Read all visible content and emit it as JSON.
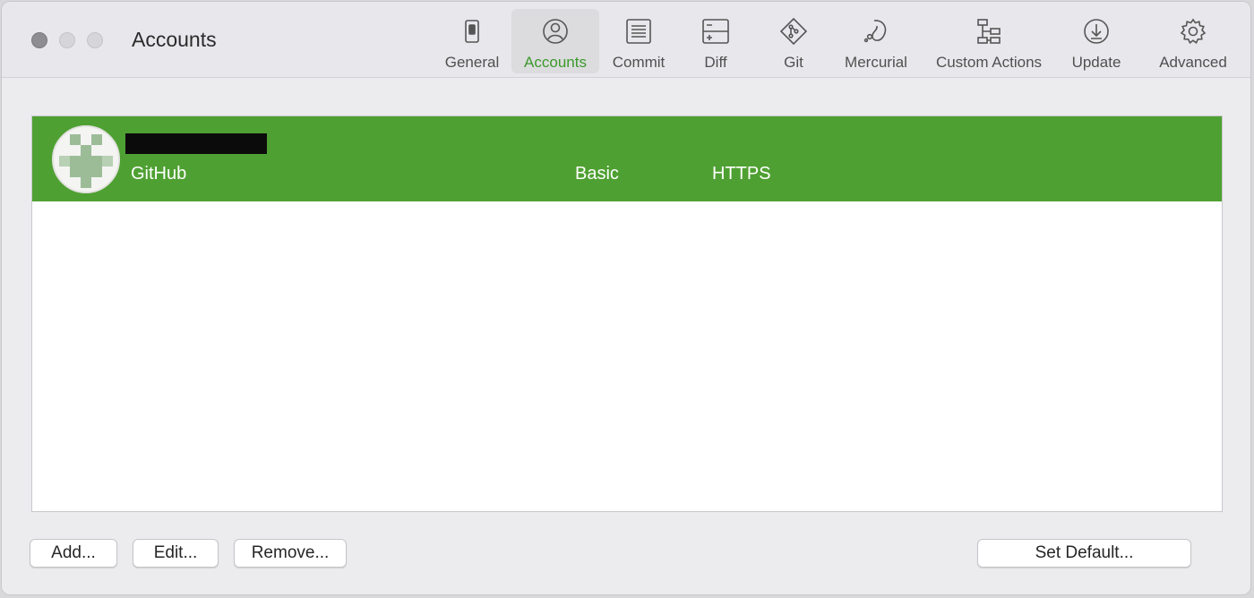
{
  "window": {
    "title": "Accounts"
  },
  "toolbar": {
    "items": [
      {
        "label": "General",
        "icon": "general-icon"
      },
      {
        "label": "Accounts",
        "icon": "accounts-icon",
        "active": true
      },
      {
        "label": "Commit",
        "icon": "commit-icon"
      },
      {
        "label": "Diff",
        "icon": "diff-icon"
      },
      {
        "label": "Git",
        "icon": "git-icon"
      },
      {
        "label": "Mercurial",
        "icon": "mercurial-icon"
      },
      {
        "label": "Custom Actions",
        "icon": "custom-actions-icon"
      },
      {
        "label": "Update",
        "icon": "update-icon"
      },
      {
        "label": "Advanced",
        "icon": "gear-icon"
      }
    ]
  },
  "accounts": {
    "rows": [
      {
        "host": "GitHub",
        "auth": "Basic",
        "protocol": "HTTPS",
        "selected": true
      }
    ]
  },
  "buttons": {
    "add": "Add...",
    "edit": "Edit...",
    "remove": "Remove...",
    "set_default": "Set Default..."
  },
  "colors": {
    "accent": "#3c9a2a",
    "selection": "#4fa032"
  }
}
